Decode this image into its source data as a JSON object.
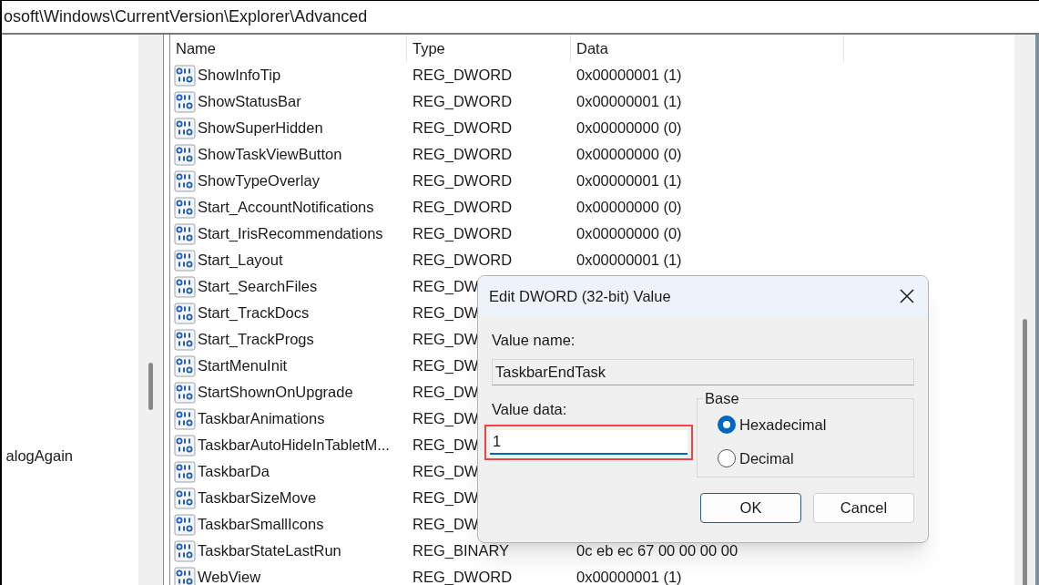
{
  "address_bar": {
    "path": "osoft\\Windows\\CurrentVersion\\Explorer\\Advanced"
  },
  "tree": {
    "items": [
      {
        "label": "alogAgain"
      }
    ]
  },
  "list": {
    "columns": [
      "Name",
      "Type",
      "Data"
    ],
    "rows": [
      {
        "name": "ShowInfoTip",
        "type": "REG_DWORD",
        "data": "0x00000001 (1)"
      },
      {
        "name": "ShowStatusBar",
        "type": "REG_DWORD",
        "data": "0x00000001 (1)"
      },
      {
        "name": "ShowSuperHidden",
        "type": "REG_DWORD",
        "data": "0x00000000 (0)"
      },
      {
        "name": "ShowTaskViewButton",
        "type": "REG_DWORD",
        "data": "0x00000000 (0)"
      },
      {
        "name": "ShowTypeOverlay",
        "type": "REG_DWORD",
        "data": "0x00000001 (1)"
      },
      {
        "name": "Start_AccountNotifications",
        "type": "REG_DWORD",
        "data": "0x00000000 (0)"
      },
      {
        "name": "Start_IrisRecommendations",
        "type": "REG_DWORD",
        "data": "0x00000000 (0)"
      },
      {
        "name": "Start_Layout",
        "type": "REG_DWORD",
        "data": "0x00000001 (1)"
      },
      {
        "name": "Start_SearchFiles",
        "type": "REG_DW"
      },
      {
        "name": "Start_TrackDocs",
        "type": "REG_DW"
      },
      {
        "name": "Start_TrackProgs",
        "type": "REG_DW"
      },
      {
        "name": "StartMenuInit",
        "type": "REG_DW"
      },
      {
        "name": "StartShownOnUpgrade",
        "type": "REG_DW"
      },
      {
        "name": "TaskbarAnimations",
        "type": "REG_DW"
      },
      {
        "name": "TaskbarAutoHideInTabletM...",
        "type": "REG_DW"
      },
      {
        "name": "TaskbarDa",
        "type": "REG_DW"
      },
      {
        "name": "TaskbarSizeMove",
        "type": "REG_DW"
      },
      {
        "name": "TaskbarSmallIcons",
        "type": "REG_DW"
      },
      {
        "name": "TaskbarStateLastRun",
        "type": "REG_BINARY",
        "data": "0c eb ec 67 00 00 00 00"
      },
      {
        "name": "WebView",
        "type": "REG_DWORD",
        "data": "0x00000001 (1)"
      }
    ]
  },
  "dialog": {
    "title": "Edit DWORD (32-bit) Value",
    "value_name_label": "Value name:",
    "value_name": "TaskbarEndTask",
    "value_data_label": "Value data:",
    "value_data": "1",
    "value_data_highlighted": true,
    "base_label": "Base",
    "base_options": [
      {
        "label": "Hexadecimal",
        "selected": true
      },
      {
        "label": "Decimal",
        "selected": false
      }
    ],
    "buttons": [
      {
        "label": "OK",
        "default": true
      },
      {
        "label": "Cancel",
        "default": false
      }
    ]
  }
}
